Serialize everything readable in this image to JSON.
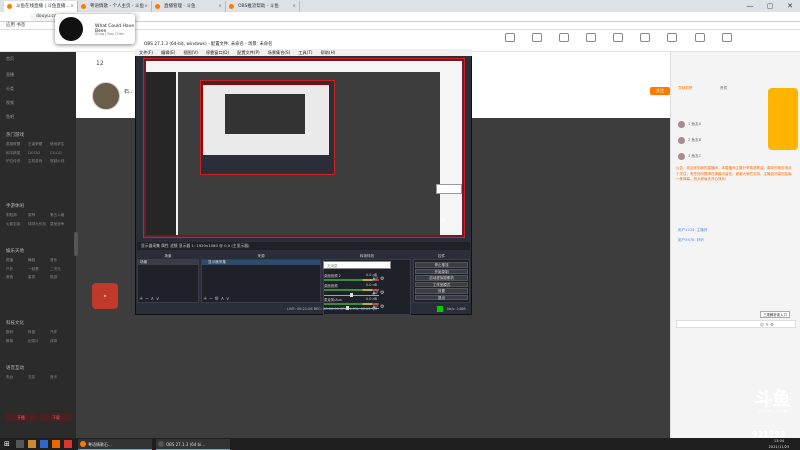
{
  "browser": {
    "tabs": [
      {
        "label": "斗鱼在线直播 | 斗鱼直播...",
        "active": true
      },
      {
        "label": "粤语情歌 - 个人主页 - 斗鱼",
        "active": false
      },
      {
        "label": "直播管理 - 斗鱼",
        "active": false
      },
      {
        "label": "OBS推流帮助 - 斗鱼",
        "active": false
      }
    ],
    "url": "douyu.com/...",
    "bookmarks": "应用   书签",
    "win_controls": [
      "—",
      "▢",
      "✕"
    ]
  },
  "media_popup": {
    "title": "What Could Have Been",
    "artist": "Sting | Ray Chen"
  },
  "room": {
    "number": "12",
    "streamer_name": "石..",
    "follow_label": "关注"
  },
  "header_icons": [
    {
      "name": "icon-1"
    },
    {
      "name": "icon-2"
    },
    {
      "name": "icon-3"
    }
  ],
  "sidebar": {
    "top_items": [
      "首页",
      "直播",
      "分类",
      "视频",
      "鱼吧"
    ],
    "sections": [
      {
        "title": "热门游戏",
        "items": [
          "英雄联盟",
          "王者荣耀",
          "绝地求生",
          "和平精英",
          "DOTA2",
          "CS:GO",
          "炉石传说",
          "主机游戏",
          "穿越火线"
        ]
      },
      {
        "title": "手游休闲",
        "items": [
          "阴阳师",
          "原神",
          "第五人格",
          "火影忍者",
          "球球大作战",
          "皇室战争"
        ]
      },
      {
        "title": "娱乐天地",
        "items": [
          "颜值",
          "舞蹈",
          "音乐",
          "户外",
          "一起看",
          "二次元",
          "美食",
          "星秀",
          "旅游"
        ]
      },
      {
        "title": "科技文化",
        "items": [
          "数码",
          "科普",
          "汽车",
          "教育",
          "纪录片",
          "体育"
        ]
      },
      {
        "title": "语音互动",
        "items": [
          "电台",
          "交友",
          "音乐"
        ]
      }
    ],
    "bottom_buttons": [
      "开播",
      "下载"
    ]
  },
  "obs": {
    "title": "OBS 27.1.3 (64-bit, windows) - 配置文件: 未命名 - 场景: 未命名",
    "menu": [
      "文件(F)",
      "编辑(E)",
      "视图(V)",
      "停靠窗口(D)",
      "配置文件(P)",
      "场景集合(S)",
      "工具(T)",
      "帮助(H)"
    ],
    "source_bar": "显示器采集     属性   滤镜   显示器 1: 1920x1080 @ 0,0 (主显示器)",
    "docks": {
      "scenes": "场景",
      "sources": "来源",
      "mixer": "混音器",
      "transitions": "转场特效",
      "controls": "控件"
    },
    "scene_item": "场景",
    "source_item": "显示器采集",
    "search_placeholder": "无消息",
    "mixer_channels": [
      {
        "label": "桌面音频",
        "db": "0.0 dB"
      },
      {
        "label": "麦克风/Aux",
        "db": "0.0 dB"
      },
      {
        "label": "桌面音频 2",
        "db": "0.0 dB"
      }
    ],
    "controls": [
      "停止推流",
      "开始录制",
      "启动虚拟摄像机",
      "工作室模式",
      "设置",
      "退出"
    ],
    "status": "LIVE: 00:21:06   REC: 00:00:00   CPU: 1.9%, 60.00 fps",
    "status_right": "kb/s: 2486"
  },
  "chat": {
    "rank_tabs": [
      "贡献周榜",
      "贵宾"
    ],
    "rank_rows": [
      "1  鱼友A",
      "2  鱼友B",
      "3  鱼友C"
    ],
    "announcement": "公告：欢迎来到我的直播间，本直播间主要分享粤语歌曲，喜欢的朋友请点个关注，有任何问题请在弹幕中留言，谢谢大家的支持，主播会尽量回复每一条弹幕，祝大家每天开心快乐！",
    "messages": [
      "用户1234: 主播好",
      "用户5678: 好听"
    ],
    "send_label": "三观解析读入口"
  },
  "brand": {
    "logo_big": "斗鱼",
    "logo_small": "DOUYU.COM",
    "view_count": "921393"
  },
  "taskbar": {
    "tasks": [
      {
        "label": "粤语情歌石...",
        "color": "#ff7a00"
      },
      {
        "label": "OBS 27.1.3 (64 bi...",
        "color": "#555"
      }
    ],
    "clock_time": "13:04",
    "clock_date": "2021/11/25"
  },
  "colors": {
    "accent": "#ff7a00",
    "obs_bg": "#2b2e38",
    "live": "#00cc00"
  }
}
